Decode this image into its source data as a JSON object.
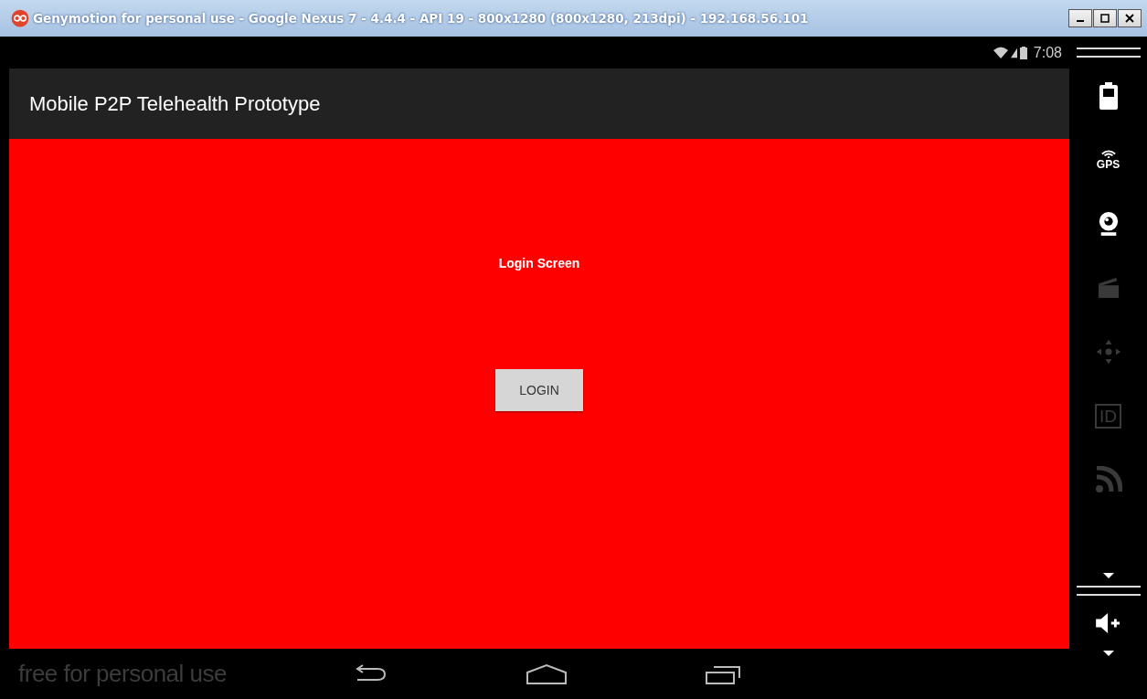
{
  "window": {
    "title": "Genymotion for personal use - Google Nexus 7 - 4.4.4 - API 19 - 800x1280 (800x1280, 213dpi) - 192.168.56.101"
  },
  "status_bar": {
    "time": "7:08"
  },
  "action_bar": {
    "title": "Mobile P2P Telehealth Prototype"
  },
  "screen": {
    "heading": "Login Screen",
    "button": "LOGIN"
  },
  "nav_bar": {
    "notice": "free for personal use"
  },
  "tools": [
    {
      "kind": "battery",
      "disabled": false
    },
    {
      "kind": "gps",
      "label": "GPS",
      "disabled": false
    },
    {
      "kind": "webcam",
      "disabled": false
    },
    {
      "kind": "media",
      "disabled": true
    },
    {
      "kind": "dpad",
      "disabled": true
    },
    {
      "kind": "id",
      "label": "ID",
      "disabled": true
    },
    {
      "kind": "network",
      "disabled": true
    }
  ],
  "lower_tools": [
    {
      "kind": "volume",
      "disabled": false
    }
  ]
}
